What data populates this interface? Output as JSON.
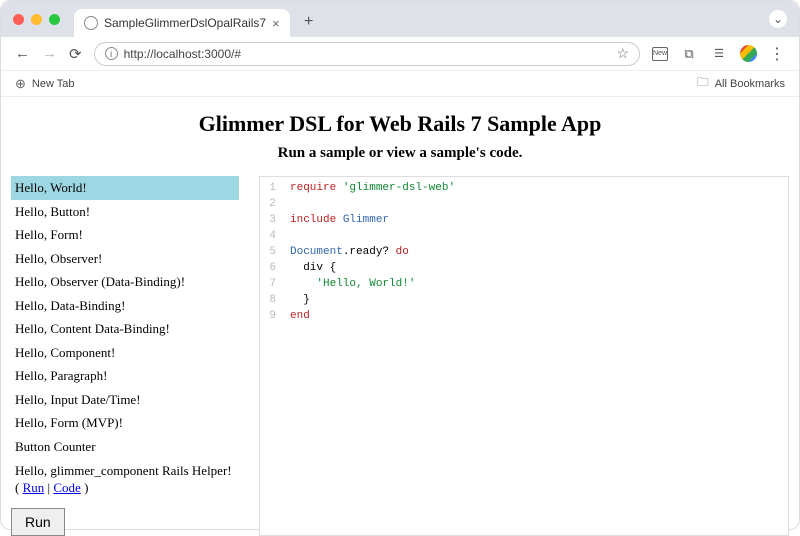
{
  "window": {
    "tab_title": "SampleGlimmerDslOpalRails7",
    "expand": "⌄"
  },
  "toolbar": {
    "url": "http://localhost:3000/#",
    "new_icon_label": "New"
  },
  "bookmarks": {
    "new_tab": "New Tab",
    "all_bookmarks": "All Bookmarks"
  },
  "page": {
    "title": "Glimmer DSL for Web Rails 7 Sample App",
    "subtitle": "Run a sample or view a sample's code."
  },
  "samples": [
    "Hello, World!",
    "Hello, Button!",
    "Hello, Form!",
    "Hello, Observer!",
    "Hello, Observer (Data-Binding)!",
    "Hello, Data-Binding!",
    "Hello, Content Data-Binding!",
    "Hello, Component!",
    "Hello, Paragraph!",
    "Hello, Input Date/Time!",
    "Hello, Form (MVP)!",
    "Button Counter"
  ],
  "helper_sample": {
    "prefix": "Hello, glimmer_component Rails Helper! ( ",
    "run": "Run",
    "sep": " | ",
    "code": "Code",
    "suffix": " )"
  },
  "run_button": "Run",
  "code": [
    {
      "n": 1,
      "segs": [
        {
          "t": "require",
          "c": "kw"
        },
        {
          "t": " "
        },
        {
          "t": "'glimmer-dsl-web'",
          "c": "str"
        }
      ]
    },
    {
      "n": 2,
      "segs": []
    },
    {
      "n": 3,
      "segs": [
        {
          "t": "include",
          "c": "kw"
        },
        {
          "t": " "
        },
        {
          "t": "Glimmer",
          "c": "const"
        }
      ]
    },
    {
      "n": 4,
      "segs": []
    },
    {
      "n": 5,
      "segs": [
        {
          "t": "Document",
          "c": "const"
        },
        {
          "t": ".ready? "
        },
        {
          "t": "do",
          "c": "kw"
        }
      ]
    },
    {
      "n": 6,
      "segs": [
        {
          "t": "  div {"
        }
      ]
    },
    {
      "n": 7,
      "segs": [
        {
          "t": "    "
        },
        {
          "t": "'Hello, World!'",
          "c": "str"
        }
      ]
    },
    {
      "n": 8,
      "segs": [
        {
          "t": "  }"
        }
      ]
    },
    {
      "n": 9,
      "segs": [
        {
          "t": "end",
          "c": "kw"
        }
      ]
    }
  ]
}
